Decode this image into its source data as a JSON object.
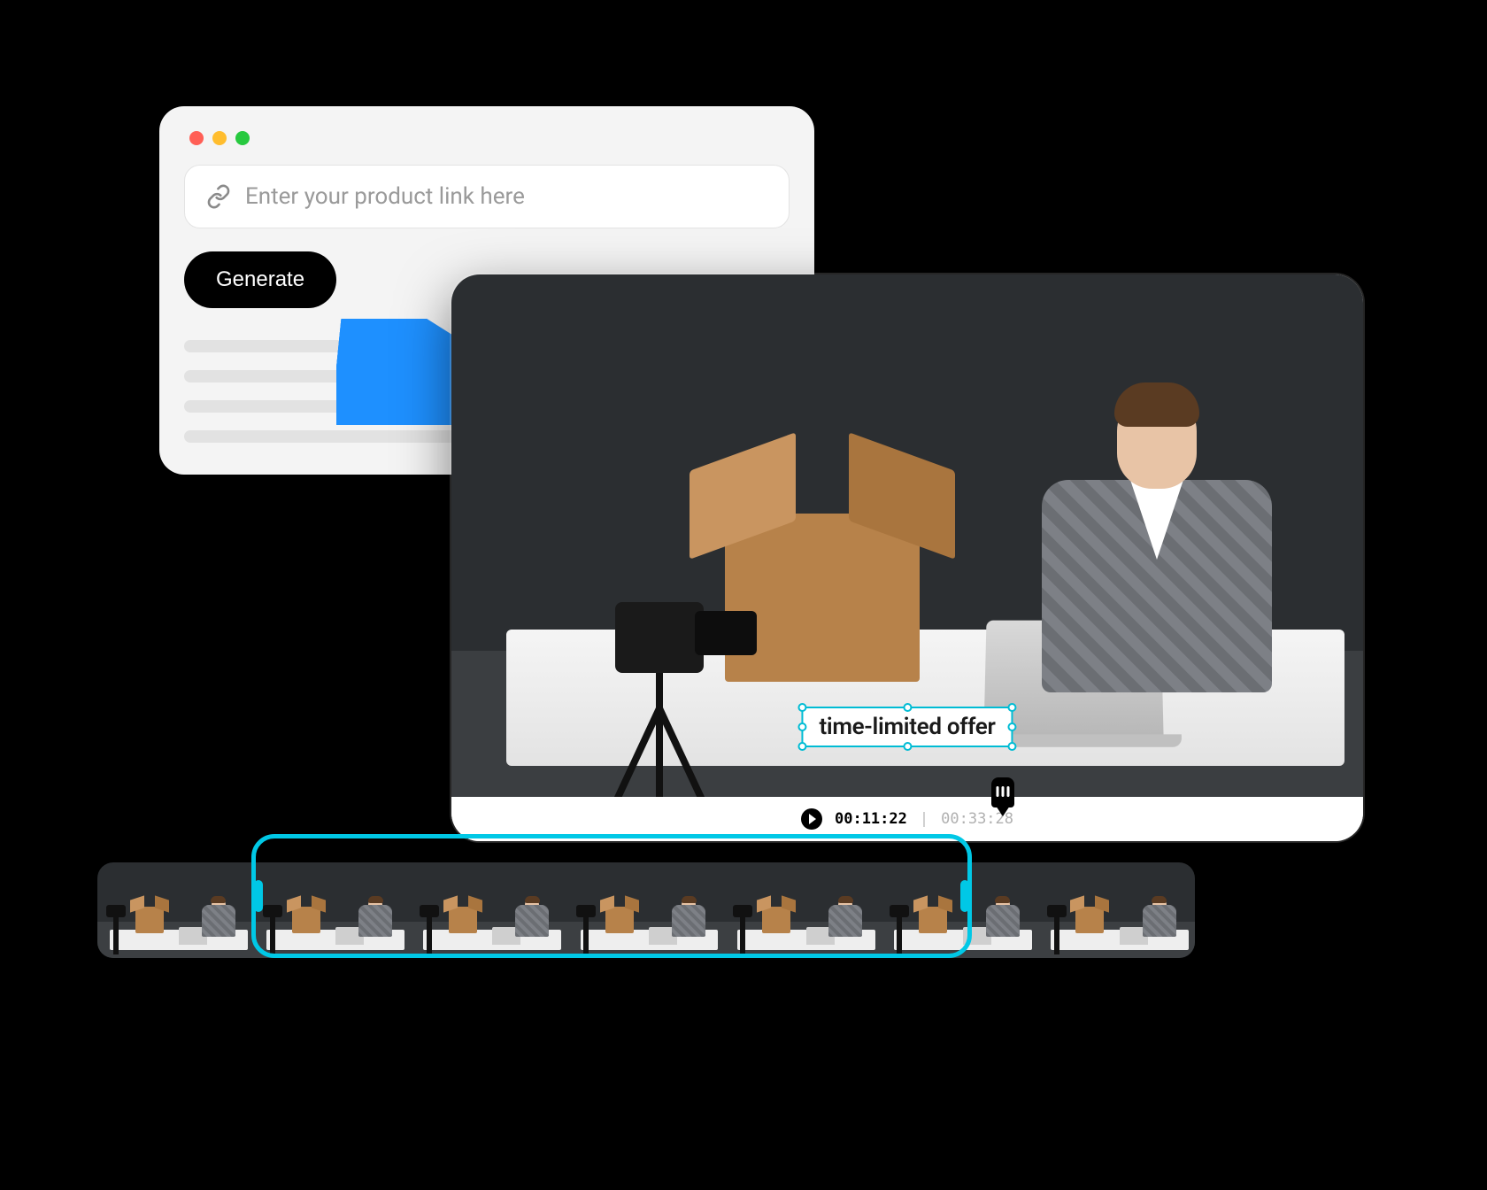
{
  "colors": {
    "accent": "#00c8e6",
    "arrow": "#1E90FF"
  },
  "input_card": {
    "placeholder": "Enter your product link here",
    "generate_label": "Generate"
  },
  "video": {
    "caption_text": "time-limited offer",
    "current_time": "00:11:22",
    "total_time": "00:33:28"
  },
  "timeline": {
    "frame_count": 7
  }
}
